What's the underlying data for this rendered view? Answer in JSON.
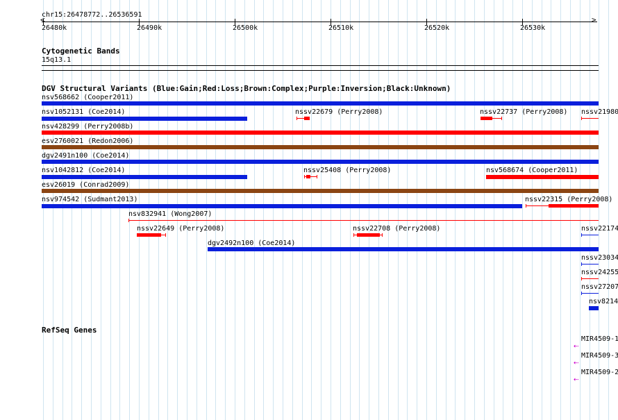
{
  "colors": {
    "gain": "#0a1fdc",
    "loss": "#ff0000",
    "complex": "#8b4513",
    "inversion": "#cc00cc",
    "grid": "#cfe4f0"
  },
  "ruler": {
    "region": "chr15:26478772..26536591",
    "ticks": [
      "26480k",
      "26490k",
      "26500k",
      "26510k",
      "26520k",
      "26530k"
    ]
  },
  "cytoband": {
    "title": "Cytogenetic Bands",
    "band": "15q13.1"
  },
  "dgv": {
    "title": "DGV Structural Variants (Blue:Gain;Red:Loss;Brown:Complex;Purple:Inversion;Black:Unknown)",
    "labels": {
      "l1": "nsv568662 (Cooper2011)",
      "l2a": "nsv1052131 (Coe2014)",
      "l2b": "nssv22679 (Perry2008)",
      "l2c": "nssv22737 (Perry2008)",
      "l2d": "nssv21980",
      "l3": "nsv428299 (Perry2008b)",
      "l4": "esv2760021 (Redon2006)",
      "l5": "dgv2491n100 (Coe2014)",
      "l6a": "nsv1042812 (Coe2014)",
      "l6b": "nssv25408 (Perry2008)",
      "l6c": "nsv568674 (Cooper2011)",
      "l7": "esv26019 (Conrad2009)",
      "l8a": "nsv974542 (Sudmant2013)",
      "l8b": "nssv22315 (Perry2008)",
      "l9": "nsv832941 (Wong2007)",
      "l10a": "nssv22649 (Perry2008)",
      "l10b": "nssv22708 (Perry2008)",
      "l10c": "nssv22174",
      "l11": "dgv2492n100 (Coe2014)",
      "l12": "nssv23034",
      "l13": "nssv24255",
      "l14": "nssv27207",
      "l15": "nsv8214"
    }
  },
  "refseq": {
    "title": "RefSeq Genes",
    "genes": [
      "MIR4509-1",
      "MIR4509-3",
      "MIR4509-2"
    ],
    "strand_glyph": "⇠"
  }
}
